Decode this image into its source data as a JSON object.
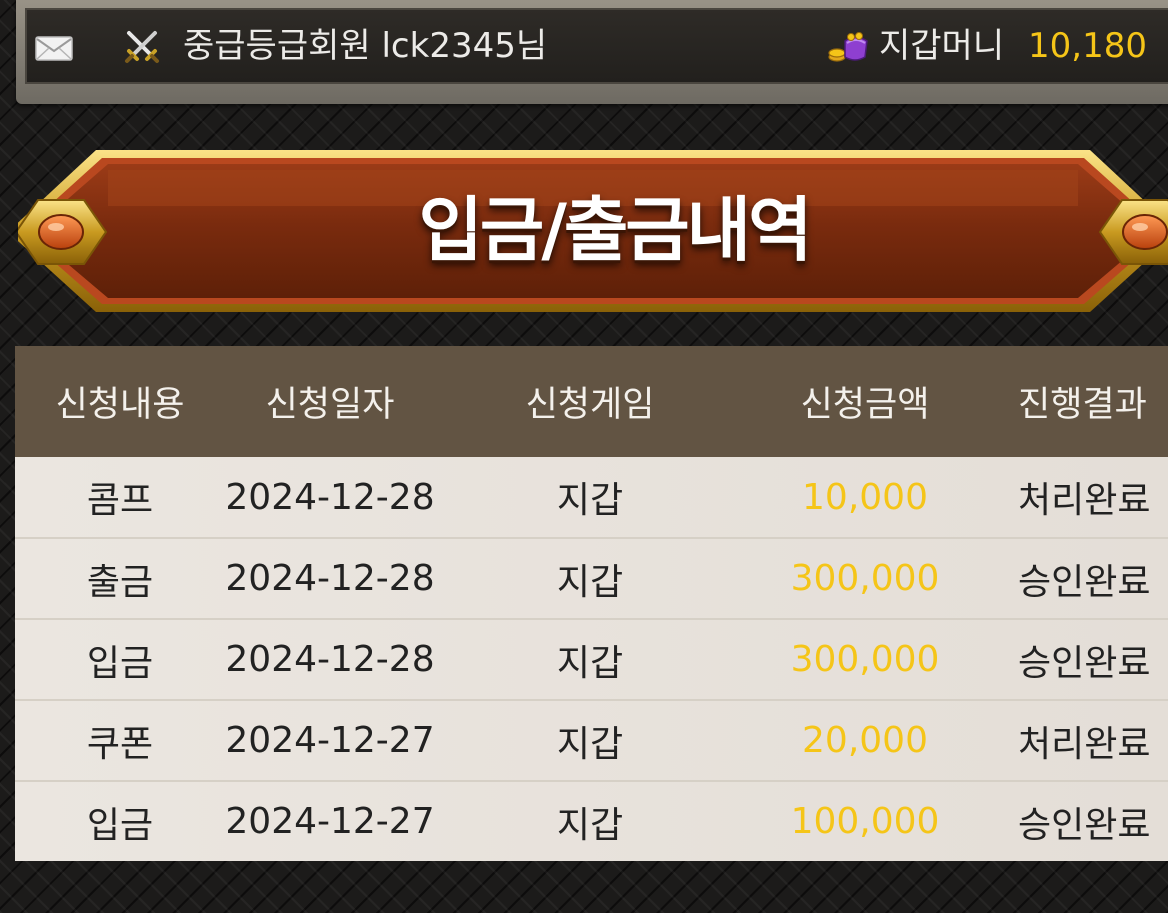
{
  "header": {
    "mail_icon": "mail-icon",
    "rank_icon": "crossed-swords-icon",
    "member_text": "중급등급회원 lck2345님",
    "wallet_icon": "coin-purse-icon",
    "wallet_label": "지갑머니",
    "wallet_value": "10,180",
    "accent_color": "#f5c518"
  },
  "banner": {
    "title": "입금/출금내역"
  },
  "table": {
    "headers": [
      "신청내용",
      "신청일자",
      "신청게임",
      "신청금액",
      "진행결과"
    ],
    "rows": [
      {
        "type": "콤프",
        "date": "2024-12-28",
        "game": "지갑",
        "amount": "10,000",
        "result": "처리완료"
      },
      {
        "type": "출금",
        "date": "2024-12-28",
        "game": "지갑",
        "amount": "300,000",
        "result": "승인완료"
      },
      {
        "type": "입금",
        "date": "2024-12-28",
        "game": "지갑",
        "amount": "300,000",
        "result": "승인완료"
      },
      {
        "type": "쿠폰",
        "date": "2024-12-27",
        "game": "지갑",
        "amount": "20,000",
        "result": "처리완료"
      },
      {
        "type": "입금",
        "date": "2024-12-27",
        "game": "지갑",
        "amount": "100,000",
        "result": "승인완료"
      }
    ]
  }
}
